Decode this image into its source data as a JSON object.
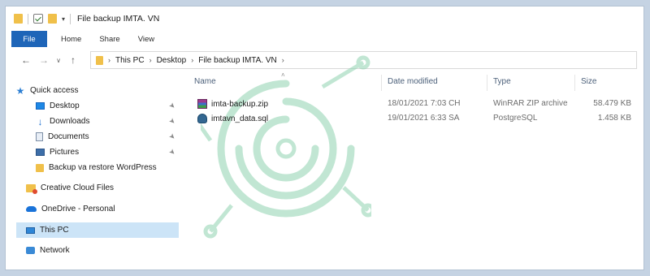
{
  "window": {
    "title": "File backup IMTA. VN",
    "quick_access_dropdown": "▾"
  },
  "ribbon": {
    "tabs": [
      "File",
      "Home",
      "Share",
      "View"
    ]
  },
  "nav": {
    "back": "←",
    "forward": "→",
    "recent": "∨",
    "up": "↑"
  },
  "address": {
    "path": [
      "This PC",
      "Desktop",
      "File backup IMTA. VN"
    ]
  },
  "sidebar": {
    "items": [
      {
        "label": "Quick access",
        "icon": "star-icon"
      },
      {
        "label": "Desktop",
        "icon": "desktop-icon",
        "pinned": true
      },
      {
        "label": "Downloads",
        "icon": "download-icon",
        "pinned": true
      },
      {
        "label": "Documents",
        "icon": "document-icon",
        "pinned": true
      },
      {
        "label": "Pictures",
        "icon": "pictures-icon",
        "pinned": true
      },
      {
        "label": "Backup va restore WordPress",
        "icon": "folder-icon"
      },
      {
        "label": "Creative Cloud Files",
        "icon": "creative-cloud-icon"
      },
      {
        "label": "OneDrive - Personal",
        "icon": "onedrive-icon"
      },
      {
        "label": "This PC",
        "icon": "this-pc-icon",
        "selected": true
      },
      {
        "label": "Network",
        "icon": "network-icon"
      }
    ]
  },
  "file_list": {
    "columns": [
      "Name",
      "Date modified",
      "Type",
      "Size"
    ],
    "sort_indicator": "˄",
    "rows": [
      {
        "name": "imta-backup.zip",
        "date": "18/01/2021 7:03 CH",
        "type": "WinRAR ZIP archive",
        "size": "58.479 KB",
        "icon": "winrar-icon"
      },
      {
        "name": "imtavn_data.sql",
        "date": "19/01/2021 6:33 SA",
        "type": "PostgreSQL",
        "size": "1.458 KB",
        "icon": "postgresql-icon"
      }
    ]
  },
  "colors": {
    "accent": "#1e65b8",
    "selection": "#cce4f7",
    "watermark": "#8fd3b0"
  }
}
